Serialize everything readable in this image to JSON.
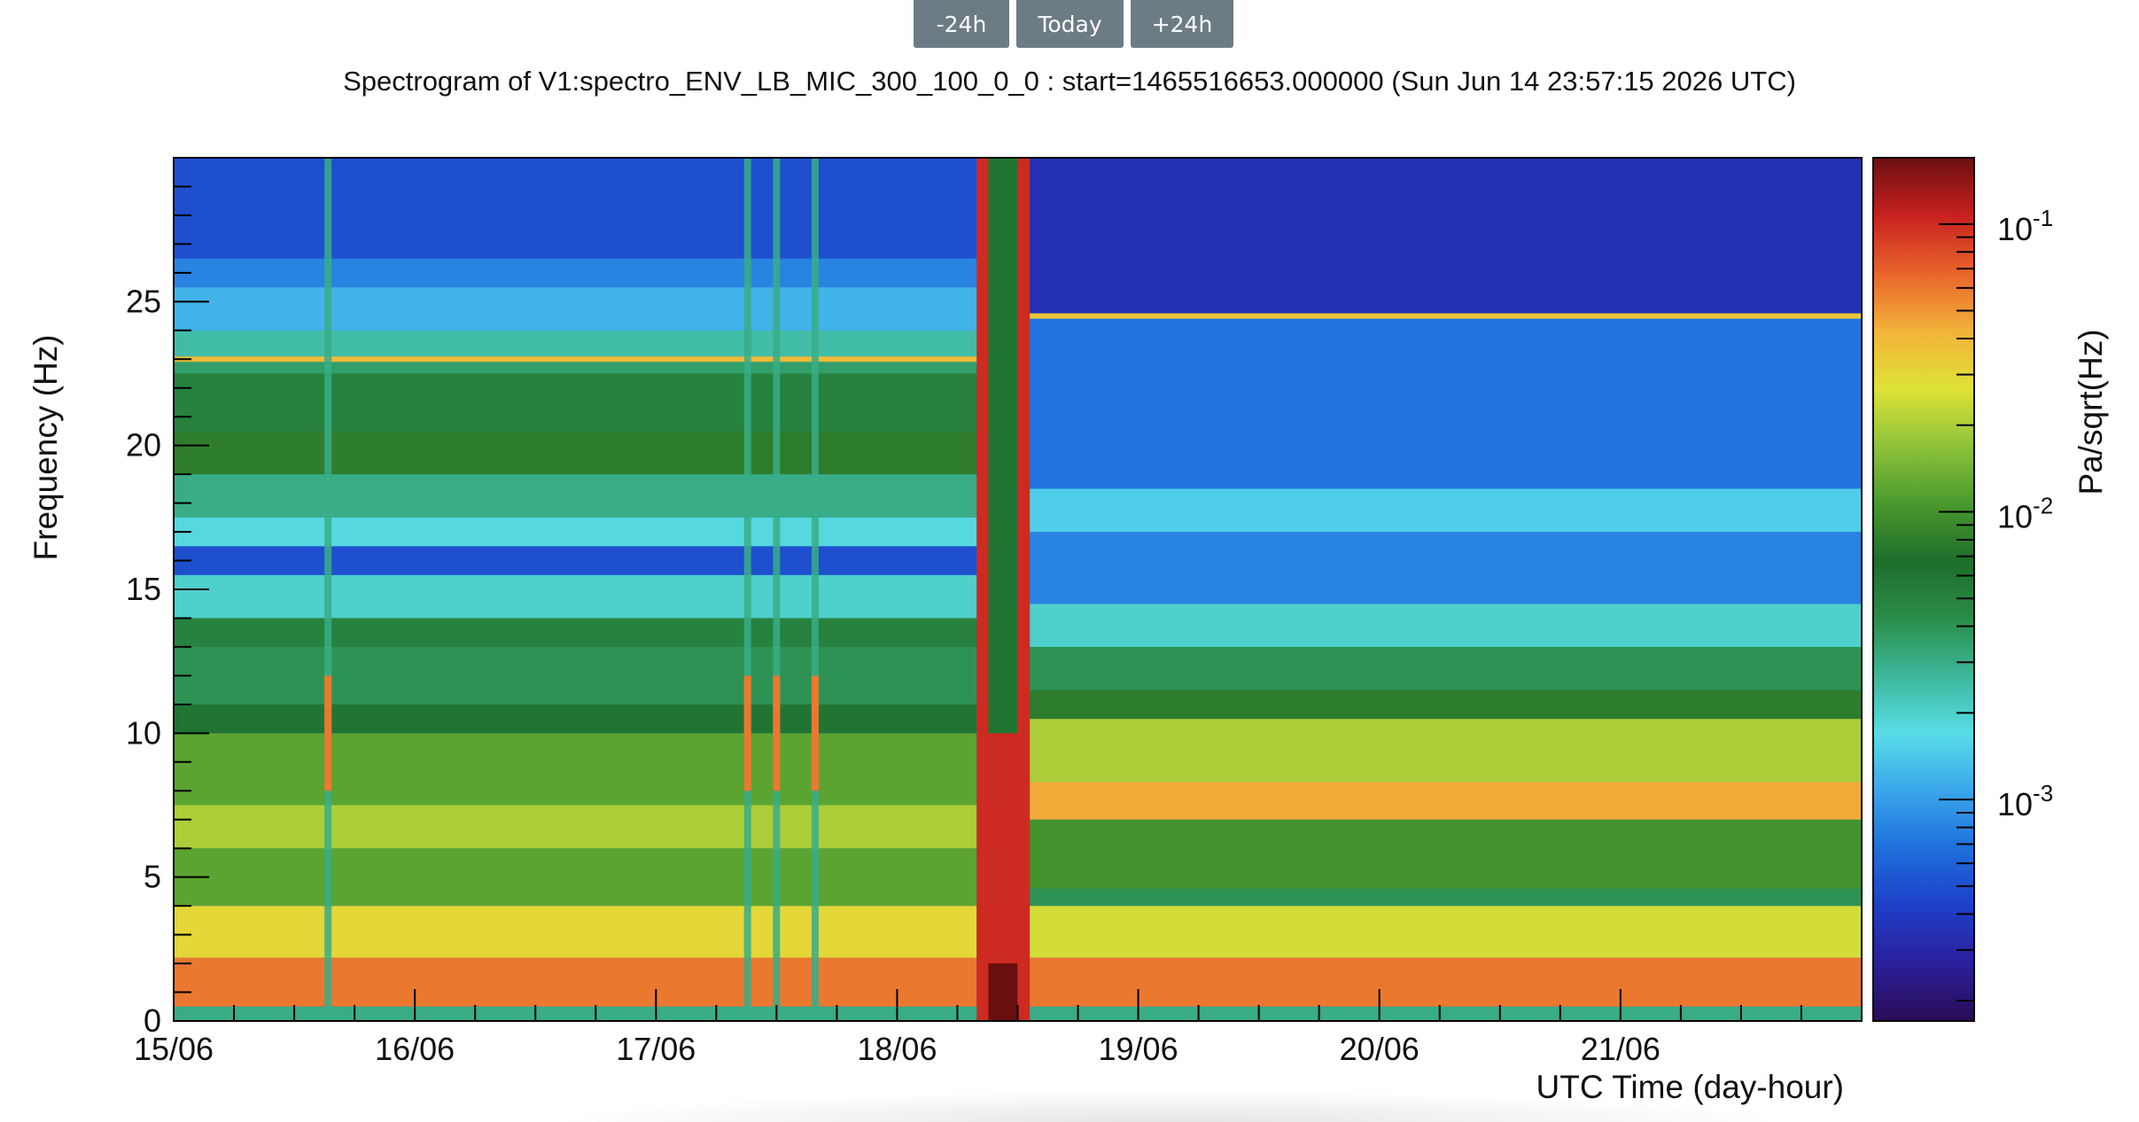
{
  "nav": {
    "prev_label": "-24h",
    "today_label": "Today",
    "next_label": "+24h"
  },
  "chart_data": {
    "type": "heatmap",
    "title": "Spectrogram of V1:spectro_ENV_LB_MIC_300_100_0_0 : start=1465516653.000000 (Sun Jun 14 23:57:15 2026 UTC)",
    "xlabel": "UTC Time (day-hour)",
    "ylabel": "Frequency (Hz)",
    "zlabel": "Pa/sqrt(Hz)",
    "x_tick_labels": [
      "15/06",
      "16/06",
      "17/06",
      "18/06",
      "19/06",
      "20/06",
      "21/06"
    ],
    "x_tick_values": [
      0,
      1,
      2,
      3,
      4,
      5,
      6
    ],
    "xlim": [
      0,
      7
    ],
    "yticks": [
      0,
      5,
      10,
      15,
      20,
      25
    ],
    "ylim": [
      0,
      30
    ],
    "z_scale": "log",
    "zlim": [
      0.00017,
      0.17
    ],
    "z_tick_labels": [
      {
        "base": "10",
        "exp": "-1",
        "value": 0.1
      },
      {
        "base": "10",
        "exp": "-2",
        "value": 0.01
      },
      {
        "base": "10",
        "exp": "-3",
        "value": 0.001
      }
    ],
    "colormap": [
      "#2a0c55",
      "#2b1f9c",
      "#1e3fc8",
      "#1f6fdc",
      "#3aa6ea",
      "#58dde8",
      "#3cb79a",
      "#2a8d48",
      "#1e6d2b",
      "#4a9a2e",
      "#8fc33a",
      "#dfe236",
      "#f3b23a",
      "#e8632b",
      "#c8211f",
      "#6a0f10"
    ],
    "regimes": [
      {
        "x_range": [
          0,
          3.33
        ],
        "bands": [
          {
            "f": [
              0,
              0.5
            ],
            "z": 0.003
          },
          {
            "f": [
              0.5,
              2.2
            ],
            "z": 0.06
          },
          {
            "f": [
              2.2,
              4
            ],
            "z": 0.03
          },
          {
            "f": [
              4,
              6
            ],
            "z": 0.012
          },
          {
            "f": [
              6,
              7.5
            ],
            "z": 0.02
          },
          {
            "f": [
              7.5,
              10
            ],
            "z": 0.012
          },
          {
            "f": [
              10,
              11
            ],
            "z": 0.006
          },
          {
            "f": [
              11,
              13
            ],
            "z": 0.004
          },
          {
            "f": [
              13,
              14
            ],
            "z": 0.005
          },
          {
            "f": [
              14,
              15.5
            ],
            "z": 0.002
          },
          {
            "f": [
              15.5,
              16.5
            ],
            "z": 0.0005
          },
          {
            "f": [
              16.5,
              17.5
            ],
            "z": 0.0018
          },
          {
            "f": [
              17.5,
              19
            ],
            "z": 0.003
          },
          {
            "f": [
              19,
              20.5
            ],
            "z": 0.008
          },
          {
            "f": [
              20.5,
              22.5
            ],
            "z": 0.005
          },
          {
            "f": [
              22.5,
              23
            ],
            "z": 0.0035
          },
          {
            "f": [
              23,
              24
            ],
            "z": 0.0025
          },
          {
            "f": [
              24,
              25.5
            ],
            "z": 0.0012
          },
          {
            "f": [
              25.5,
              26.5
            ],
            "z": 0.0008
          },
          {
            "f": [
              26.5,
              30
            ],
            "z": 0.0005
          }
        ],
        "lines": [
          {
            "f": 23,
            "z": 0.04
          }
        ]
      },
      {
        "x_range": [
          3.55,
          7
        ],
        "bands": [
          {
            "f": [
              0,
              0.5
            ],
            "z": 0.003
          },
          {
            "f": [
              0.5,
              2.2
            ],
            "z": 0.06
          },
          {
            "f": [
              2.2,
              4
            ],
            "z": 0.025
          },
          {
            "f": [
              4,
              4.6
            ],
            "z": 0.004
          },
          {
            "f": [
              4.6,
              7
            ],
            "z": 0.01
          },
          {
            "f": [
              7,
              8.3
            ],
            "z": 0.045
          },
          {
            "f": [
              8.3,
              10.5
            ],
            "z": 0.02
          },
          {
            "f": [
              10.5,
              11.5
            ],
            "z": 0.008
          },
          {
            "f": [
              11.5,
              13
            ],
            "z": 0.004
          },
          {
            "f": [
              13,
              14.5
            ],
            "z": 0.002
          },
          {
            "f": [
              14.5,
              17
            ],
            "z": 0.0008
          },
          {
            "f": [
              17,
              18.5
            ],
            "z": 0.0015
          },
          {
            "f": [
              18.5,
              24.5
            ],
            "z": 0.0007
          },
          {
            "f": [
              24.5,
              30
            ],
            "z": 0.00035
          }
        ],
        "lines": [
          {
            "f": 24.5,
            "z": 0.035
          }
        ]
      }
    ],
    "transient": {
      "x_range": [
        3.33,
        3.55
      ],
      "z": 0.1,
      "core_z": 0.006
    },
    "glitches": [
      0.64,
      2.38,
      2.5,
      2.66
    ]
  }
}
